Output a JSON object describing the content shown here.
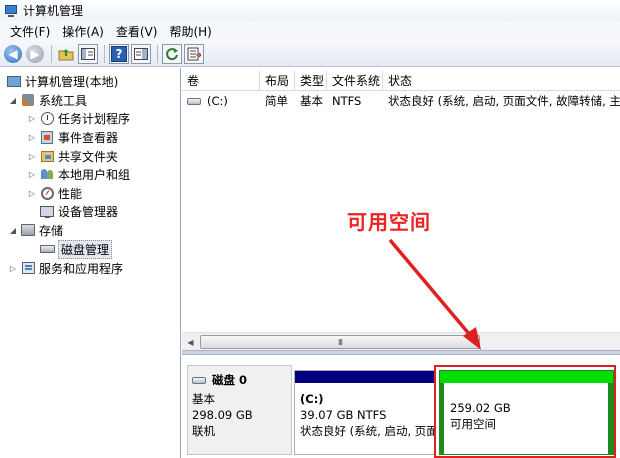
{
  "window": {
    "title": "计算机管理"
  },
  "menubar": {
    "items": [
      "文件(F)",
      "操作(A)",
      "查看(V)",
      "帮助(H)"
    ]
  },
  "toolbar": {
    "icons": [
      "back-arrow-icon",
      "forward-arrow-icon",
      "up-folder-icon",
      "show-hide-tree-icon",
      "help-icon",
      "properties-icon",
      "refresh-icon",
      "export-icon"
    ]
  },
  "tree": {
    "root": "计算机管理(本地)",
    "system_tools": "系统工具",
    "task_scheduler": "任务计划程序",
    "event_viewer": "事件查看器",
    "shared_folders": "共享文件夹",
    "local_users": "本地用户和组",
    "performance": "性能",
    "device_manager": "设备管理器",
    "storage": "存储",
    "disk_management": "磁盘管理",
    "services_apps": "服务和应用程序"
  },
  "volume_table": {
    "headers": [
      "卷",
      "布局",
      "类型",
      "文件系统",
      "状态"
    ],
    "rows": [
      {
        "volume": "(C:)",
        "layout": "简单",
        "type": "基本",
        "filesystem": "NTFS",
        "status": "状态良好 (系统, 启动, 页面文件, 故障转储, 主分"
      }
    ]
  },
  "disk": {
    "name": "磁盘 0",
    "type": "基本",
    "size": "298.09 GB",
    "state": "联机",
    "partitions": [
      {
        "label": "(C:)",
        "size_fs": "39.07 GB NTFS",
        "status": "状态良好 (系统, 启动, 页面",
        "color": "#000080"
      },
      {
        "size": "259.02 GB",
        "desc": "可用空间",
        "color": "#00dd00"
      }
    ]
  },
  "annotation": {
    "text": "可用空间",
    "color": "#ee2222"
  }
}
